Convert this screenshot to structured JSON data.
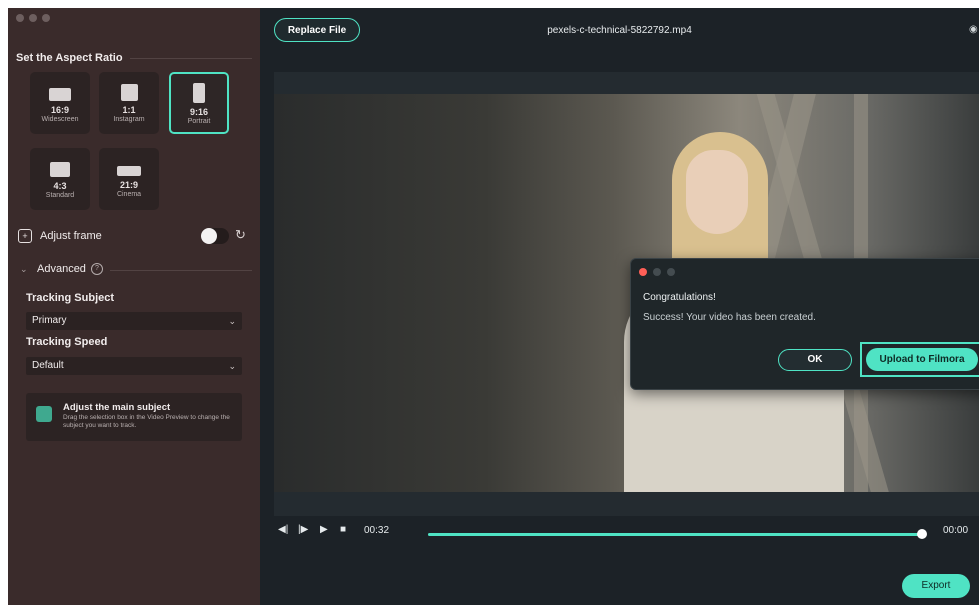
{
  "sidebar": {
    "section_title": "Set the Aspect Ratio",
    "ratios": [
      {
        "ratio": "16:9",
        "name": "Widescreen",
        "selected": false
      },
      {
        "ratio": "1:1",
        "name": "Instagram",
        "selected": false
      },
      {
        "ratio": "9:16",
        "name": "Portrait",
        "selected": true
      },
      {
        "ratio": "4:3",
        "name": "Standard",
        "selected": false
      },
      {
        "ratio": "21:9",
        "name": "Cinema",
        "selected": false
      }
    ],
    "adjust_frame_label": "Adjust frame",
    "advanced_label": "Advanced",
    "tracking_subject_label": "Tracking Subject",
    "tracking_subject_value": "Primary",
    "tracking_speed_label": "Tracking Speed",
    "tracking_speed_value": "Default",
    "subject_card": {
      "title": "Adjust the main subject",
      "description": "Drag the selection box in the Video Preview to change the subject you want to track."
    }
  },
  "header": {
    "replace_button": "Replace File",
    "filename": "pexels-c-technical-5822792.mp4"
  },
  "dialog": {
    "title": "Congratulations!",
    "message": "Success! Your video has been created.",
    "ok_label": "OK",
    "upload_label": "Upload to Filmora"
  },
  "player": {
    "current_time": "00:32",
    "end_time": "00:00",
    "progress": 1.0
  },
  "footer": {
    "export_label": "Export"
  },
  "colors": {
    "accent": "#4fe3c4",
    "sidebar_bg": "#3a2b2b",
    "main_bg": "#1c2227"
  }
}
